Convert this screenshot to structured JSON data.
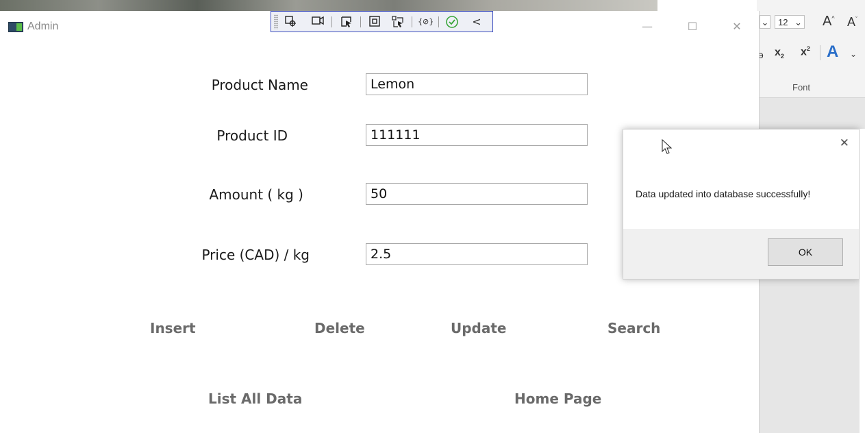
{
  "window": {
    "title": "Admin",
    "controls": {
      "minimize": "—",
      "maximize": "☐",
      "close": "✕"
    }
  },
  "debug_toolbar": {
    "icons": [
      "select-element-icon",
      "record-icon",
      "pointer-icon",
      "adorner-icon",
      "track-focus-icon",
      "binding-icon",
      "checkmark-icon",
      "collapse-icon"
    ],
    "collapse_glyph": "<"
  },
  "form": {
    "product_name": {
      "label": "Product Name",
      "value": "Lemon"
    },
    "product_id": {
      "label": "Product ID",
      "value": "111111"
    },
    "amount": {
      "label": "Amount ( kg )",
      "value": "50"
    },
    "price": {
      "label": "Price (CAD) / kg",
      "value": "2.5"
    }
  },
  "actions": {
    "insert": "Insert",
    "delete": "Delete",
    "update": "Update",
    "search": "Search",
    "list_all": "List All Data",
    "home_page": "Home Page"
  },
  "message_box": {
    "text": "Data updated into database successfully!",
    "ok_label": "OK",
    "close_glyph": "✕"
  },
  "ribbon": {
    "font_size": "12",
    "group_label": "Font",
    "grow_font": "A",
    "shrink_font": "A",
    "subscript": "x",
    "superscript": "x",
    "text_effects": "A"
  },
  "colors": {
    "toolbar_border": "#3c4dbf",
    "action_text": "#6a6a6a",
    "ribbon_bg": "#e6e6e6",
    "check_green": "#3aa63a"
  }
}
